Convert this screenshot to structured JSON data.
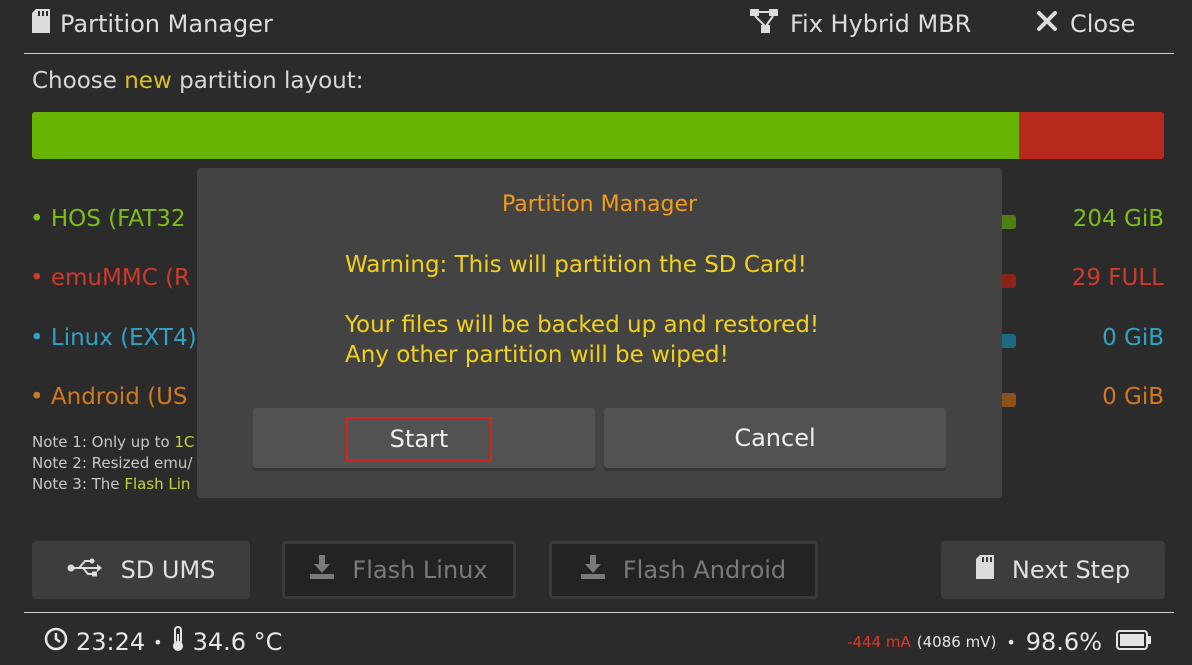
{
  "header": {
    "title": "Partition Manager",
    "fix_hybrid_mbr": "Fix Hybrid MBR",
    "close": "Close"
  },
  "layout_label": {
    "prefix": "Choose ",
    "accent": "new",
    "suffix": " partition layout:"
  },
  "usage_bar": {
    "hos_fraction": 0.872,
    "emummc_fraction": 0.128,
    "colors": {
      "hos": "#66b300",
      "emummc": "#b7291c"
    }
  },
  "partitions": [
    {
      "label": "• HOS (FAT32",
      "value": "204 GiB",
      "color": "#7bbf1a"
    },
    {
      "label": "• emuMMC (R",
      "value": "29 FULL",
      "color": "#cf3a2b"
    },
    {
      "label": "• Linux (EXT4)",
      "value": "0 GiB",
      "color": "#2fa3c6"
    },
    {
      "label": "• Android (US",
      "value": "0 GiB",
      "color": "#d07a20"
    }
  ],
  "notes": [
    {
      "prefix": "Note 1: Only up to ",
      "accent": "1C"
    },
    {
      "prefix": "Note 2: Resized emu/",
      "accent": ""
    },
    {
      "prefix": "Note 3: The ",
      "accent": "Flash Lin"
    }
  ],
  "buttons": {
    "sd_ums": "SD UMS",
    "flash_linux": "Flash Linux",
    "flash_android": "Flash Android",
    "next_step": "Next Step"
  },
  "footer": {
    "time": "23:24",
    "sep": "•",
    "temperature": "34.6 °C",
    "current": "-444 mA",
    "voltage": "(4086 mV)",
    "battery": "98.6%"
  },
  "dialog": {
    "title": "Partition Manager",
    "line1": "Warning: This will partition the SD Card!",
    "line2": "Your files will be backed up and restored!",
    "line3": "Any other partition will be wiped!",
    "start": "Start",
    "cancel": "Cancel"
  },
  "colors": {
    "accent_orange": "#f39c1c",
    "warning_yellow": "#f2d11b",
    "focus_red": "#d9221c"
  }
}
